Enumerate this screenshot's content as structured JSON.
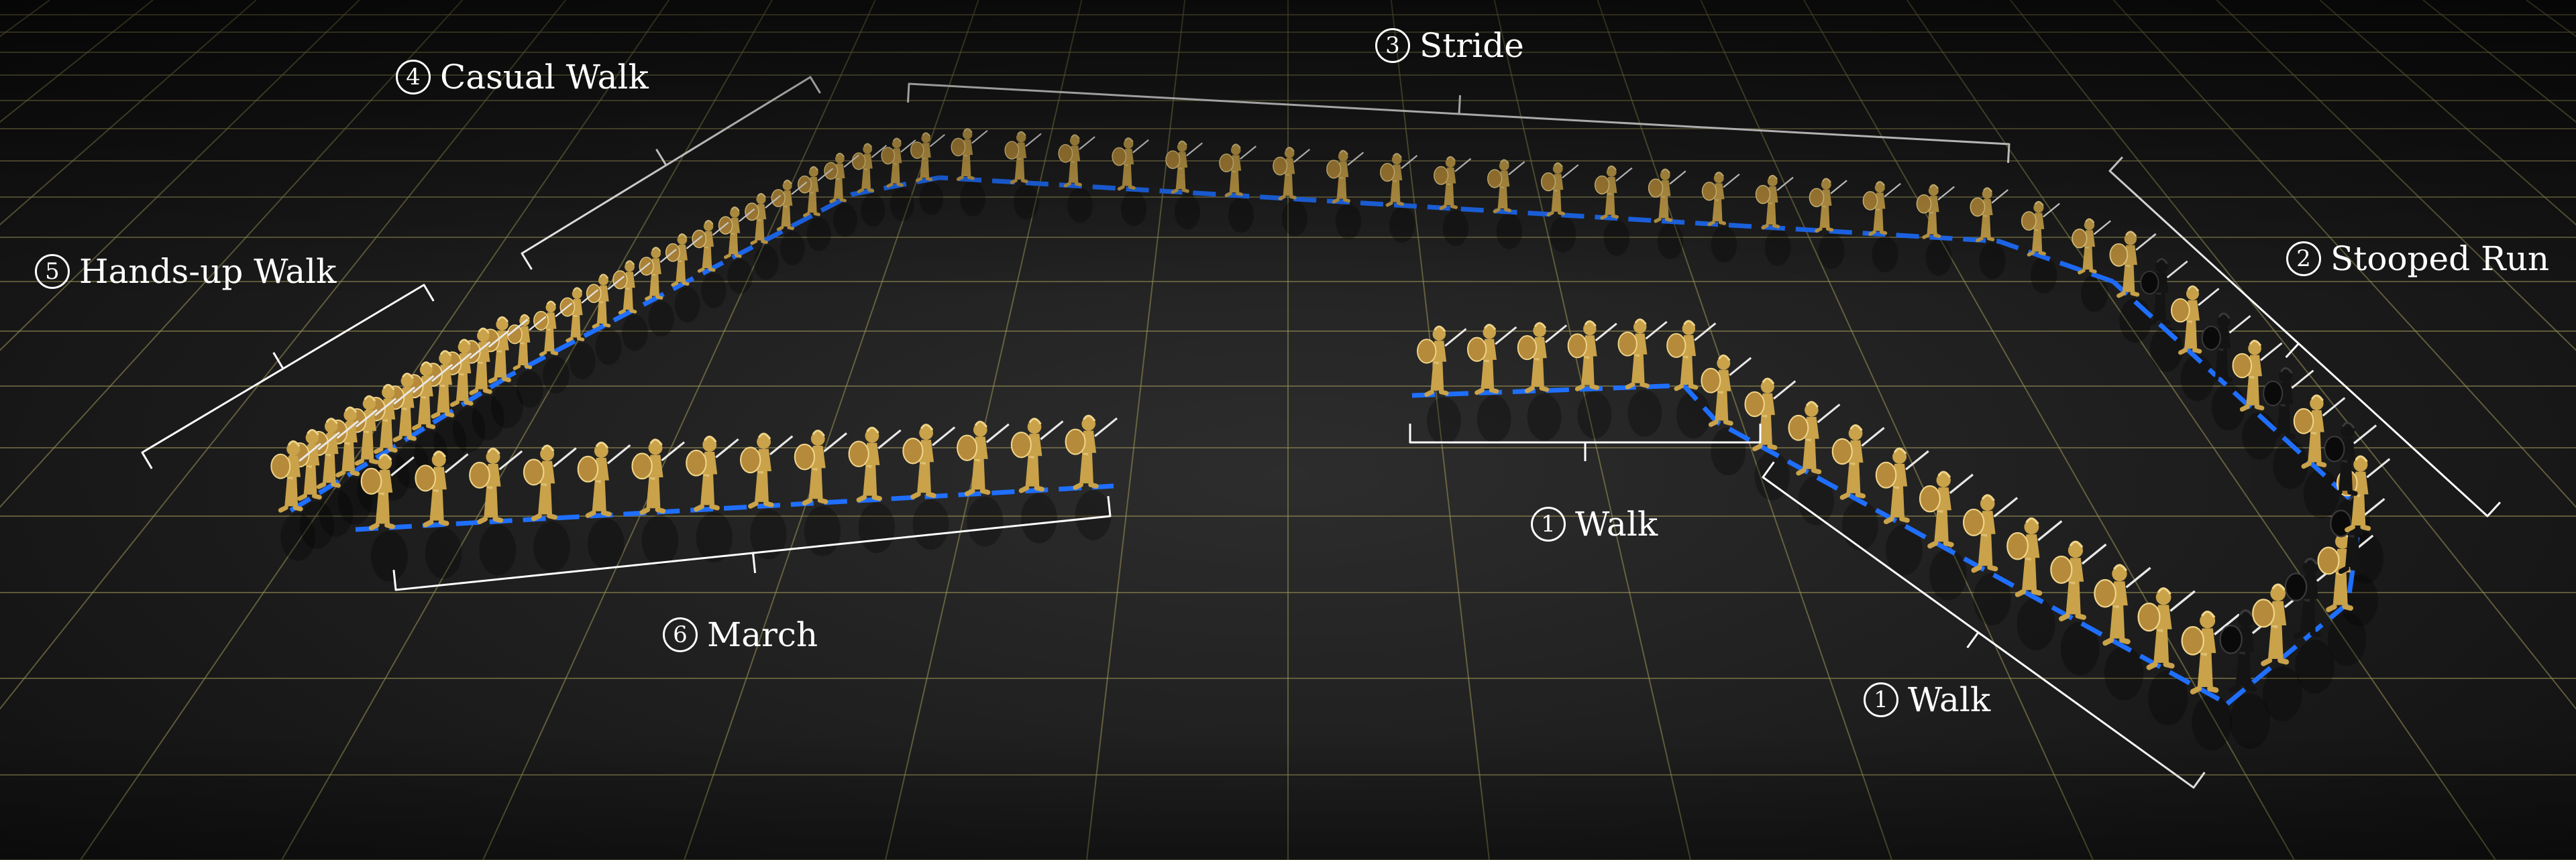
{
  "labels": {
    "stride": {
      "number": "3",
      "text": "Stride"
    },
    "casual_walk": {
      "number": "4",
      "text": "Casual Walk"
    },
    "hands_up": {
      "number": "5",
      "text": "Hands-up Walk"
    },
    "stooped_run": {
      "number": "2",
      "text": "Stooped Run"
    },
    "walk_a": {
      "number": "1",
      "text": "Walk"
    },
    "walk_b": {
      "number": "1",
      "text": "Walk"
    },
    "march": {
      "number": "6",
      "text": "March"
    }
  },
  "colors": {
    "background": "#1c1c1c",
    "grid": "#9b9457",
    "path": "#1f6fff",
    "bracket": "#ffffff",
    "figure_gold": "#c9a24a",
    "figure_dark": "#141414"
  }
}
